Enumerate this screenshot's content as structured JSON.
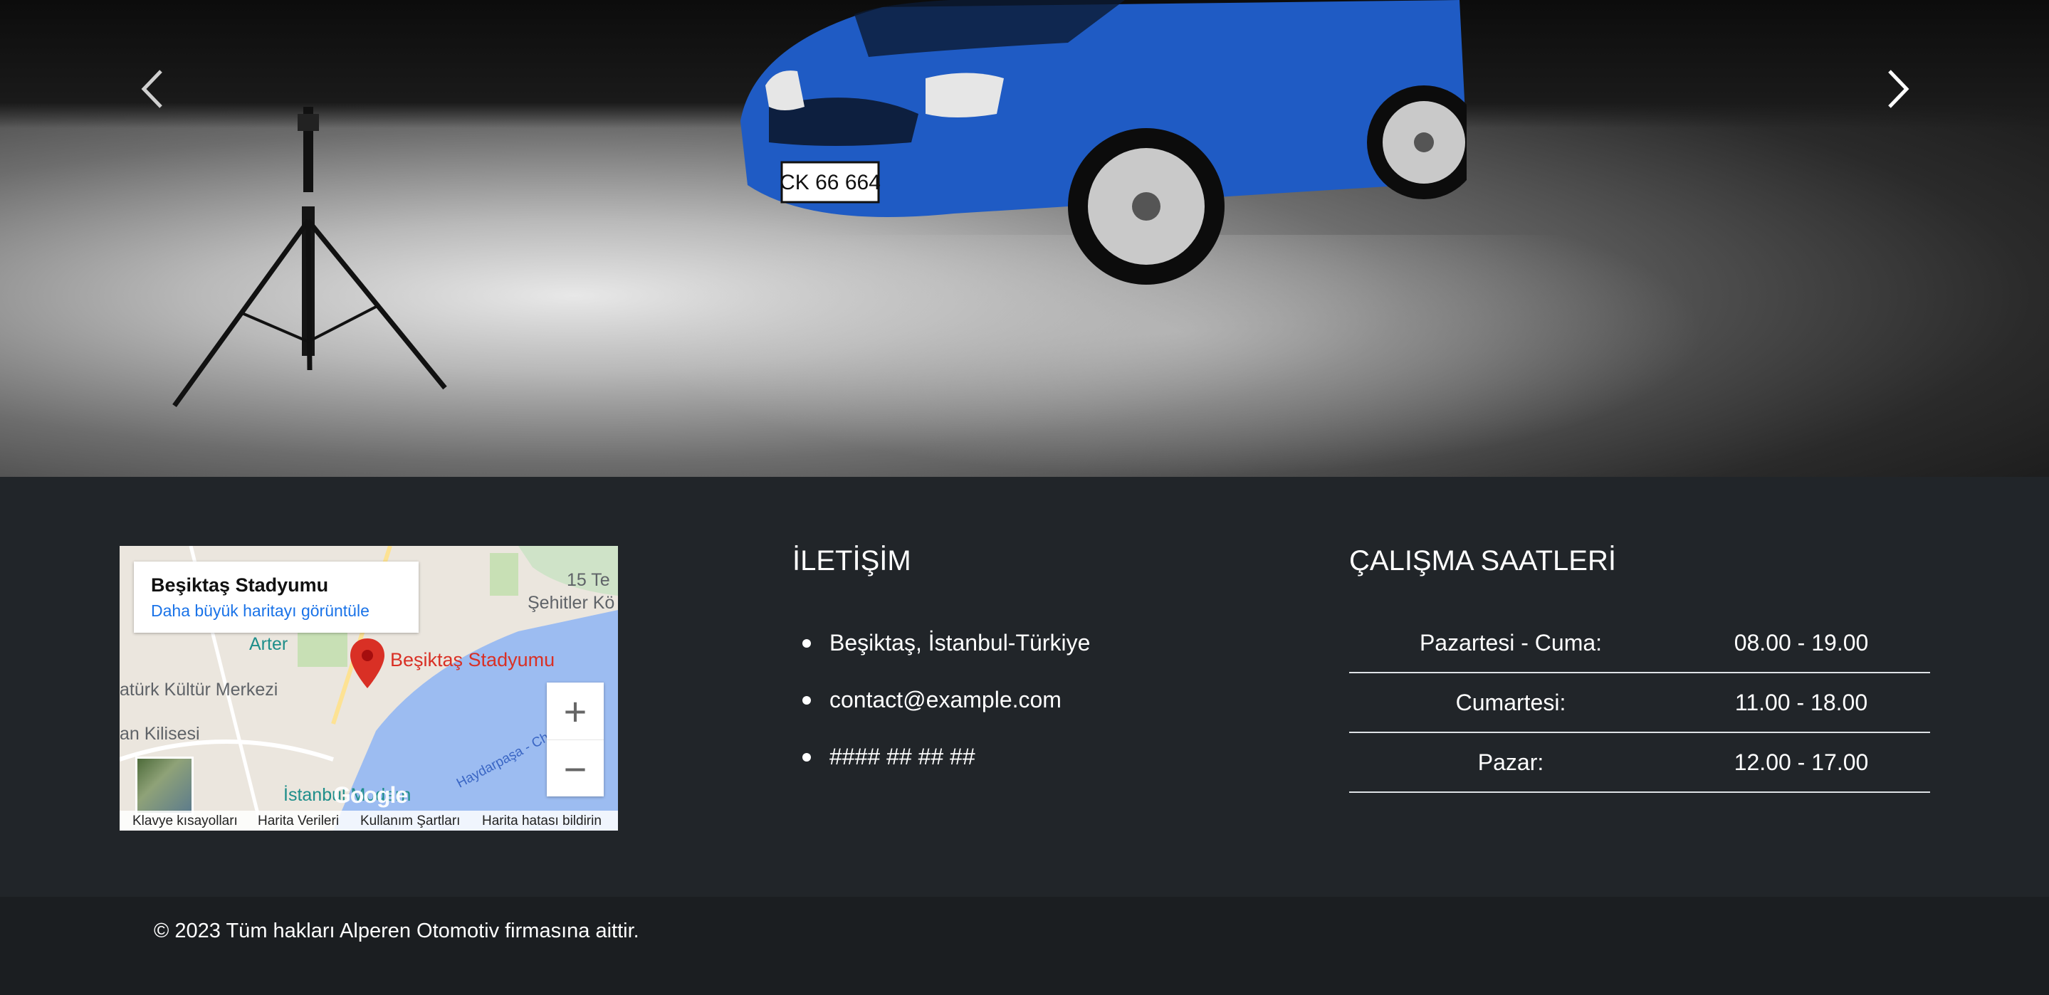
{
  "hero": {
    "car_plate": "CK 66 664",
    "prev_icon": "chevron-left-icon",
    "next_icon": "chevron-right-icon"
  },
  "map": {
    "place_title": "Beşiktaş Stadyumu",
    "larger_map_link": "Daha büyük haritayı görüntüle",
    "pin_label": "Beşiktaş Stadyumu",
    "labels": {
      "arter": "Arter",
      "kultur": "atürk Kültür Merkezi",
      "kilisesi": "an Kilisesi",
      "istanbul_modern": "İstanbul Modern",
      "sehitler": "Şehitler Kö",
      "te": "15 Te",
      "haydarpasa": "Haydarpaşa - Cho"
    },
    "google_logo": "Google",
    "zoom_in": "+",
    "zoom_out": "−",
    "attribution": {
      "shortcuts": "Klavye kısayolları",
      "data": "Harita Verileri",
      "terms": "Kullanım Şartları",
      "report": "Harita hatası bildirin"
    }
  },
  "contact": {
    "title": "İLETİŞİM",
    "items": [
      "Beşiktaş, İstanbul-Türkiye",
      "contact@example.com",
      "#### ## ## ##"
    ]
  },
  "hours": {
    "title": "ÇALIŞMA SAATLERİ",
    "rows": [
      {
        "day": "Pazartesi - Cuma:",
        "time": "08.00 - 19.00"
      },
      {
        "day": "Cumartesi:",
        "time": "11.00 - 18.00"
      },
      {
        "day": "Pazar:",
        "time": "12.00 - 17.00"
      }
    ]
  },
  "footer": {
    "copyright": "© 2023 Tüm hakları Alperen Otomotiv firmasına aittir."
  },
  "colors": {
    "background": "#212529",
    "footer_bar": "#1b1e21",
    "car": "#1f5bc4",
    "link": "#1a73e8",
    "pin": "#d93025"
  }
}
